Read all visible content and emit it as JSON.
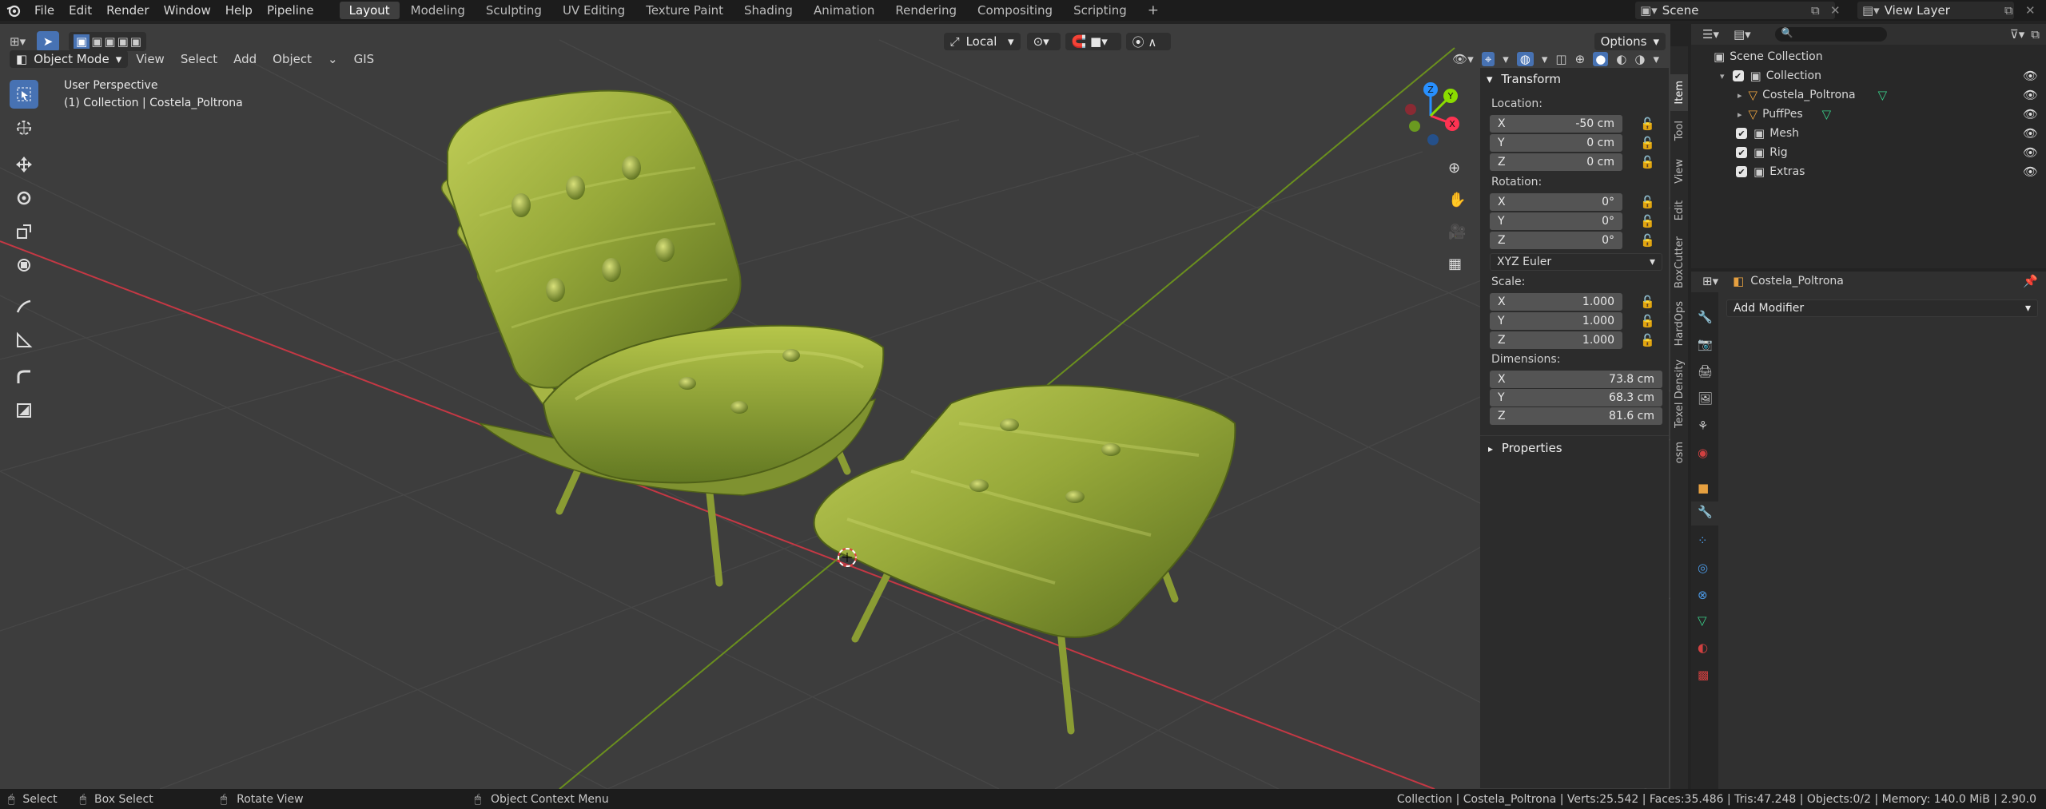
{
  "menu": [
    "File",
    "Edit",
    "Render",
    "Window",
    "Help",
    "Pipeline"
  ],
  "workspaces": [
    {
      "label": "Layout",
      "active": true
    },
    {
      "label": "Modeling"
    },
    {
      "label": "Sculpting"
    },
    {
      "label": "UV Editing"
    },
    {
      "label": "Texture Paint"
    },
    {
      "label": "Shading"
    },
    {
      "label": "Animation"
    },
    {
      "label": "Rendering"
    },
    {
      "label": "Compositing"
    },
    {
      "label": "Scripting"
    }
  ],
  "add_workspace": "+",
  "scene": {
    "name": "Scene",
    "view_layer": "View Layer"
  },
  "viewport": {
    "mode": "Object Mode",
    "menus": [
      "View",
      "Select",
      "Add",
      "Object"
    ],
    "gis": "GIS",
    "orientation": "Local",
    "options": "Options",
    "info_line1": "User Perspective",
    "info_line2": "(1) Collection | Costela_Poltrona",
    "gizmo": {
      "x": "X",
      "y": "Y",
      "z": "Z"
    }
  },
  "npanel": {
    "transform_title": "Transform",
    "location_label": "Location:",
    "location": [
      {
        "axis": "X",
        "value": "-50 cm"
      },
      {
        "axis": "Y",
        "value": "0 cm"
      },
      {
        "axis": "Z",
        "value": "0 cm"
      }
    ],
    "rotation_label": "Rotation:",
    "rotation": [
      {
        "axis": "X",
        "value": "0°"
      },
      {
        "axis": "Y",
        "value": "0°"
      },
      {
        "axis": "Z",
        "value": "0°"
      }
    ],
    "rotation_mode": "XYZ Euler",
    "scale_label": "Scale:",
    "scale": [
      {
        "axis": "X",
        "value": "1.000"
      },
      {
        "axis": "Y",
        "value": "1.000"
      },
      {
        "axis": "Z",
        "value": "1.000"
      }
    ],
    "dimensions_label": "Dimensions:",
    "dimensions": [
      {
        "axis": "X",
        "value": "73.8 cm"
      },
      {
        "axis": "Y",
        "value": "68.3 cm"
      },
      {
        "axis": "Z",
        "value": "81.6 cm"
      }
    ],
    "properties_title": "Properties"
  },
  "side_tabs": [
    "Item",
    "Tool",
    "View",
    "Edit",
    "BoxCutter",
    "HardOps",
    "Texel Density",
    "osm"
  ],
  "outliner": {
    "root": "Scene Collection",
    "items": [
      "Collection",
      "Costela_Poltrona",
      "PuffPes",
      "Mesh",
      "Rig",
      "Extras"
    ]
  },
  "properties": {
    "object_name": "Costela_Poltrona",
    "add_modifier": "Add Modifier"
  },
  "status": {
    "select": "Select",
    "box_select": "Box Select",
    "rotate_view": "Rotate View",
    "context_menu": "Object Context Menu",
    "stats": "Collection | Costela_Poltrona | Verts:25.542 | Faces:35.486 | Tris:47.248 | Objects:0/2 | Memory: 140.0 MiB | 2.90.0"
  },
  "colors": {
    "accent": "#4772b3",
    "x_axis": "#ff3352",
    "y_axis": "#8bdc00",
    "z_axis": "#2890ff",
    "mesh": "#9aab3a"
  }
}
